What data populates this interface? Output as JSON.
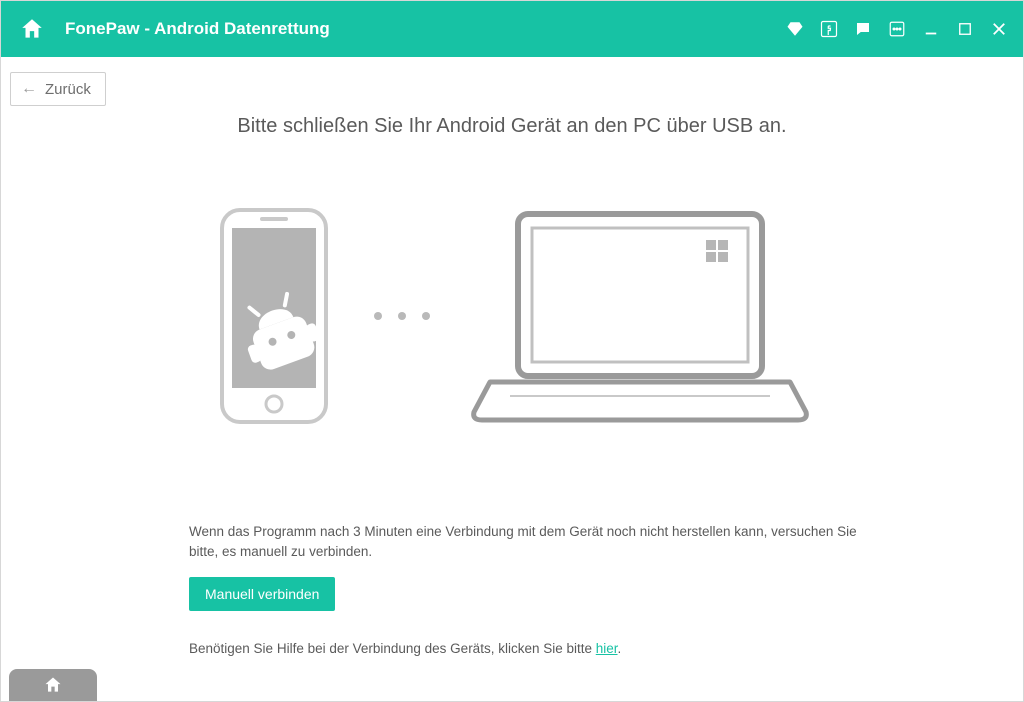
{
  "app": {
    "title": "FonePaw - Android Datenrettung"
  },
  "nav": {
    "back": "Zurück"
  },
  "main": {
    "headline": "Bitte schließen Sie Ihr Android Gerät an den PC über USB an.",
    "info_text": "Wenn das Programm nach 3 Minuten eine Verbindung mit dem Gerät noch nicht herstellen kann, versuchen Sie bitte, es manuell zu verbinden.",
    "manual_button": "Manuell verbinden",
    "help_prefix": "Benötigen Sie Hilfe bei der Verbindung des Geräts, klicken Sie bitte ",
    "help_link": "hier",
    "help_suffix": "."
  }
}
